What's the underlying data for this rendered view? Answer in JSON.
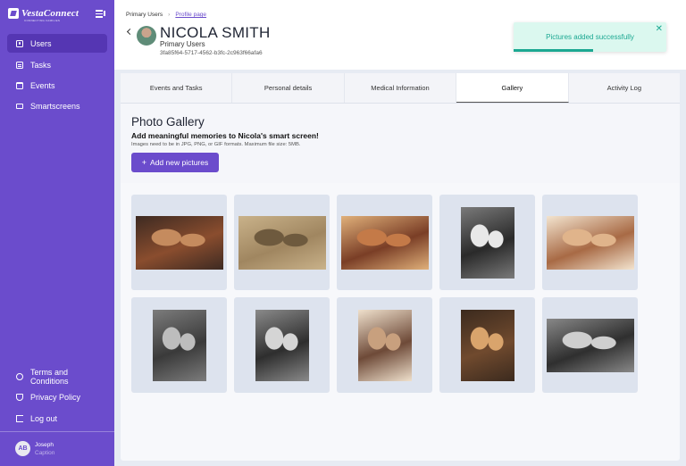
{
  "app": {
    "logo_text": "VestaConnect",
    "logo_sub": "CONNECTING FAMILIES"
  },
  "sidebar": {
    "items": [
      {
        "label": "Users",
        "icon": "user-icon"
      },
      {
        "label": "Tasks",
        "icon": "list-icon"
      },
      {
        "label": "Events",
        "icon": "calendar-icon"
      },
      {
        "label": "Smartscreens",
        "icon": "monitor-icon"
      }
    ],
    "footer_items": [
      {
        "label": "Terms and Conditions",
        "icon": "info-icon"
      },
      {
        "label": "Privacy Policy",
        "icon": "shield-icon"
      },
      {
        "label": "Log out",
        "icon": "logout-icon"
      }
    ],
    "user": {
      "initials": "AB",
      "name": "Joseph",
      "role": "Caption"
    }
  },
  "breadcrumb": {
    "root": "Primary Users",
    "current": "Profile page"
  },
  "profile": {
    "name": "NICOLA SMITH",
    "role": "Primary Users",
    "id": "3fa85f64-5717-4562-b3fc-2c963f66afa6"
  },
  "toast": {
    "message": "Pictures added successfully",
    "progress": 0.52
  },
  "tabs": [
    "Events and Tasks",
    "Personal details",
    "Medical Information",
    "Gallery",
    "Activity Log"
  ],
  "active_tab": "Gallery",
  "gallery": {
    "title": "Photo Gallery",
    "subtitle": "Add meaningful memories to Nicola's smart screen!",
    "hint": "Images need to be in JPG, PNG, or GIF formats. Maximum file size: 5MB.",
    "add_button": "Add new pictures",
    "photos": [
      {
        "description": "group of friends",
        "palette": [
          "#8a4d2e",
          "#c58b5e",
          "#3d2a22"
        ]
      },
      {
        "description": "picnic by car",
        "palette": [
          "#a08660",
          "#6e5a3e",
          "#c9b28a"
        ]
      },
      {
        "description": "dancing at party",
        "palette": [
          "#7a3e26",
          "#c47a48",
          "#e0b07a"
        ]
      },
      {
        "description": "wedding couple",
        "palette": [
          "#2a2a2a",
          "#e8e8e8",
          "#7a7a7a"
        ]
      },
      {
        "description": "woman smiling with sunglasses",
        "palette": [
          "#a86a45",
          "#e0b48b",
          "#f3e4cf"
        ]
      },
      {
        "description": "family portrait",
        "palette": [
          "#3a3a3a",
          "#bdbdbd",
          "#7c7c7c"
        ]
      },
      {
        "description": "baby portrait",
        "palette": [
          "#2e2e2e",
          "#d5d5d5",
          "#8a8a8a"
        ]
      },
      {
        "description": "woman with cake",
        "palette": [
          "#6e4a38",
          "#c8a07e",
          "#efe0cc"
        ]
      },
      {
        "description": "graduation friends",
        "palette": [
          "#704a2e",
          "#d9a46c",
          "#3b2a1e"
        ]
      },
      {
        "description": "pregnant woman outdoors",
        "palette": [
          "#2f2f2f",
          "#cfcfcf",
          "#888888"
        ]
      }
    ]
  }
}
